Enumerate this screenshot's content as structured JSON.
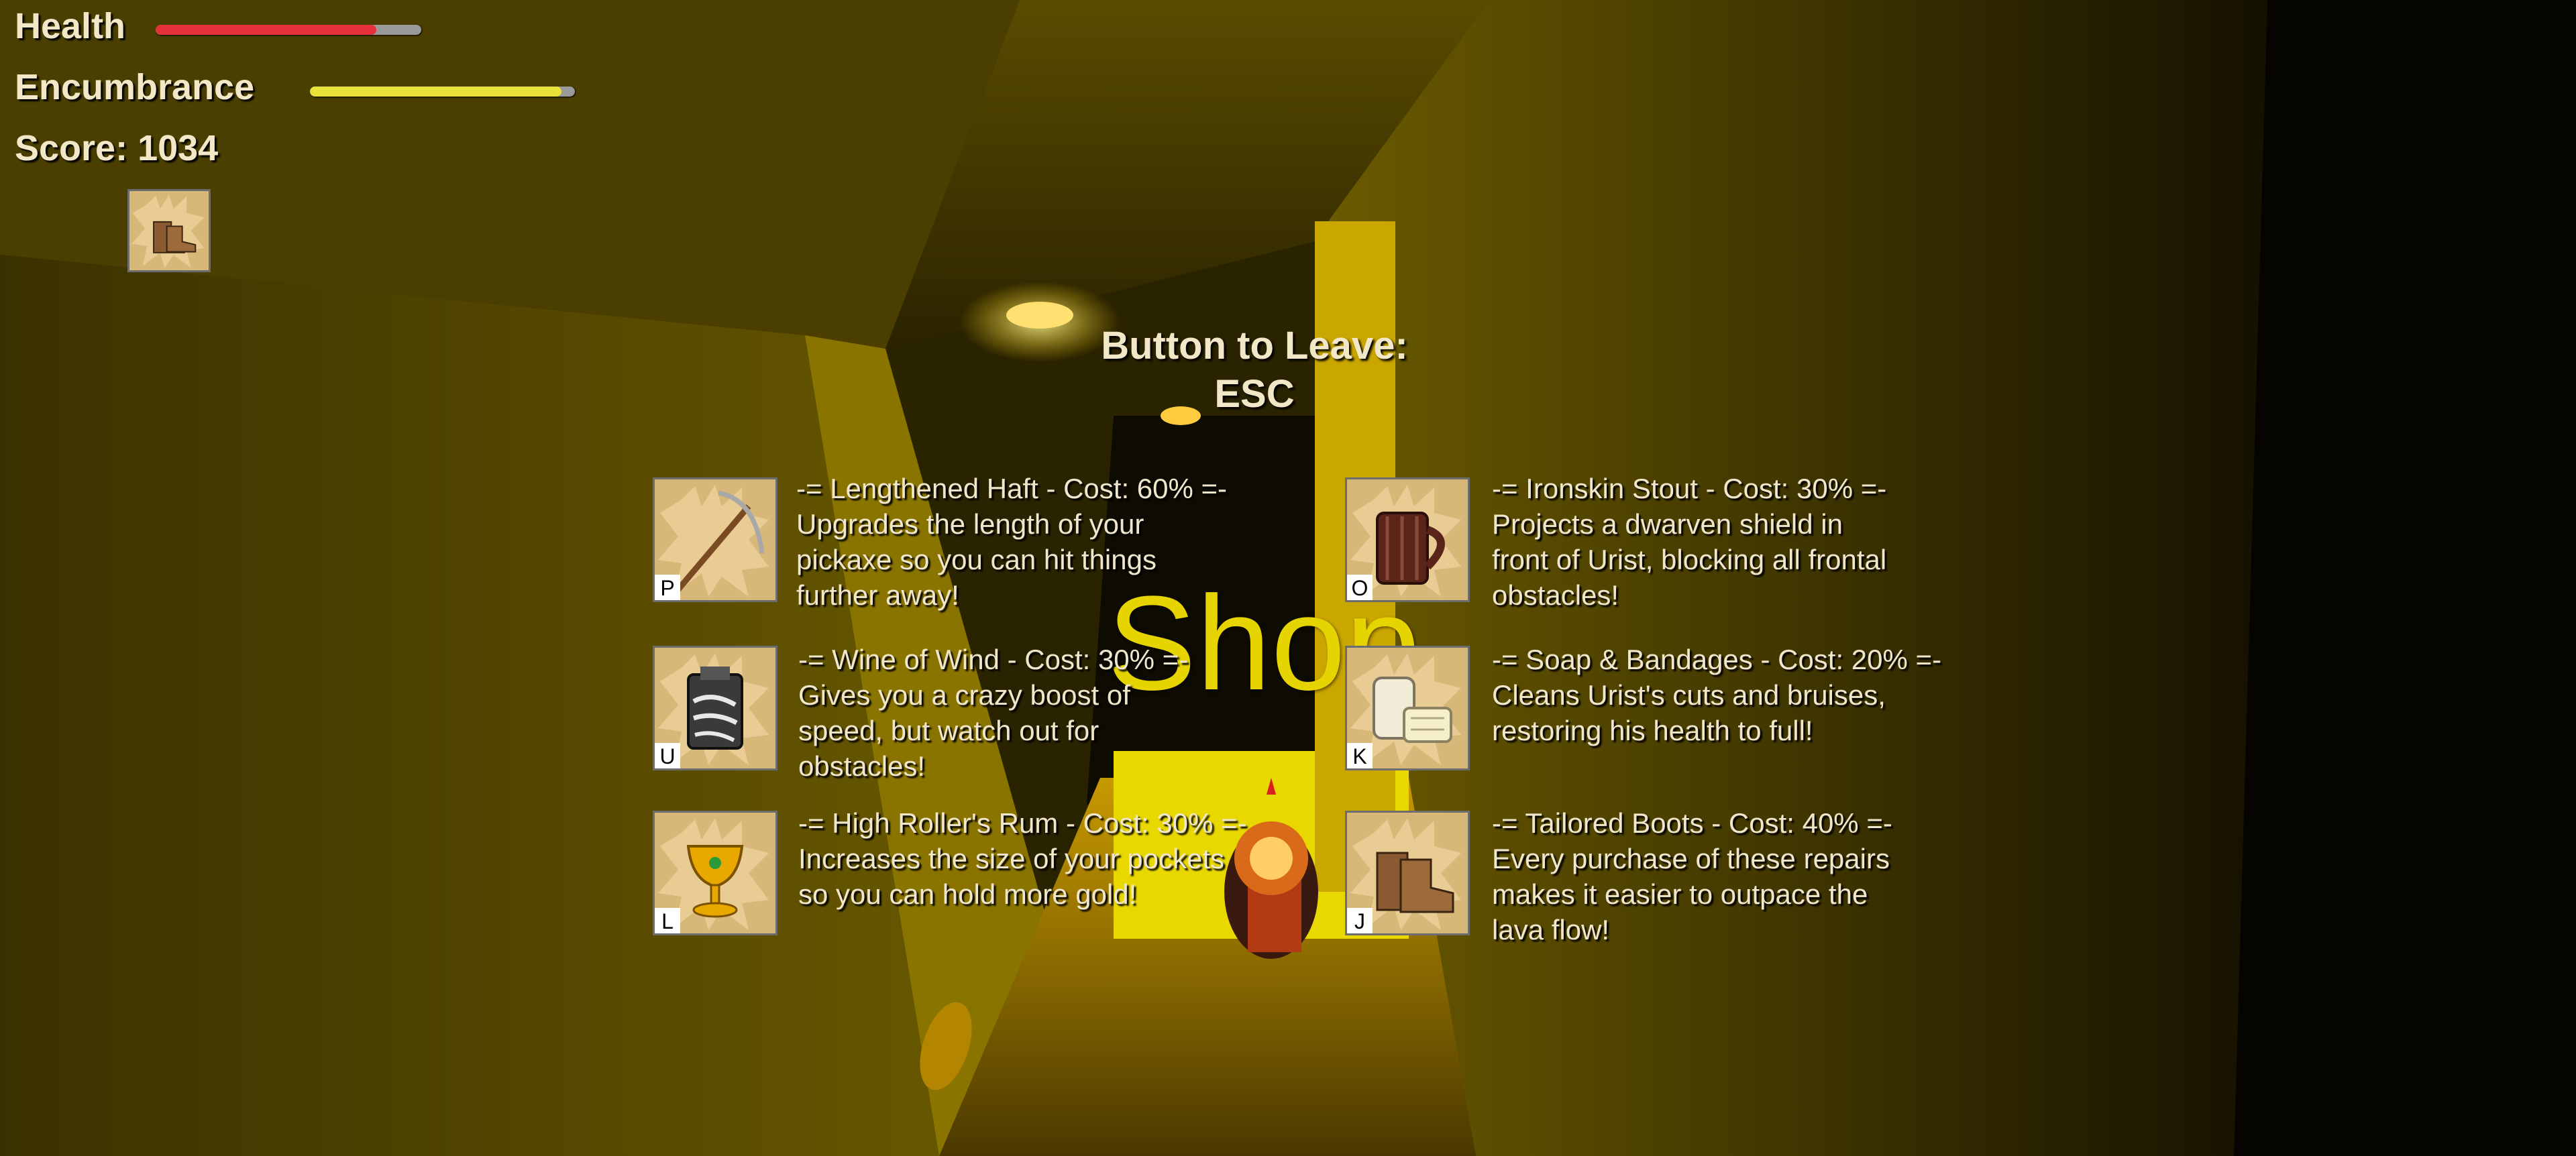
{
  "hud": {
    "health_label": "Health",
    "health_fraction": 0.83,
    "health_color": "#e5323a",
    "encumbrance_label": "Encumbrance",
    "encumbrance_fraction": 0.95,
    "encumbrance_color": "#e8e23a",
    "score_label": "Score: 1034",
    "equipped_icon": "boots-icon"
  },
  "prompt": {
    "line1": "Button to Leave:",
    "line2": "ESC"
  },
  "shop_word": "Shop",
  "items": [
    {
      "key": "P",
      "icon": "pickaxe-icon",
      "title": "-= Lengthened Haft - Cost: 60% =-",
      "lines": [
        "Upgrades the length of your",
        "pickaxe so you can hit things",
        "further away!"
      ]
    },
    {
      "key": "O",
      "icon": "beer-mug-icon",
      "title": "-= Ironskin Stout - Cost: 30% =-",
      "lines": [
        "Projects a dwarven shield in",
        "front of Urist, blocking all frontal",
        "obstacles!"
      ]
    },
    {
      "key": "U",
      "icon": "wind-wine-icon",
      "title": "-= Wine of Wind - Cost: 30% =-",
      "lines": [
        "Gives you a crazy boost of",
        "speed, but watch out for",
        "obstacles!"
      ]
    },
    {
      "key": "K",
      "icon": "soap-bandages-icon",
      "title": "-= Soap & Bandages - Cost: 20% =-",
      "lines": [
        "Cleans Urist's cuts and bruises,",
        "restoring his health to full!"
      ]
    },
    {
      "key": "L",
      "icon": "goblet-icon",
      "title": "-= High Roller's Rum - Cost: 30% =-",
      "lines": [
        "Increases the size of your pockets",
        "so you can hold more gold!"
      ]
    },
    {
      "key": "J",
      "icon": "boots-icon",
      "title": "-= Tailored Boots - Cost: 40% =-",
      "lines": [
        "Every purchase of these repairs",
        "makes it easier to outpace the",
        "lava flow!"
      ]
    }
  ]
}
